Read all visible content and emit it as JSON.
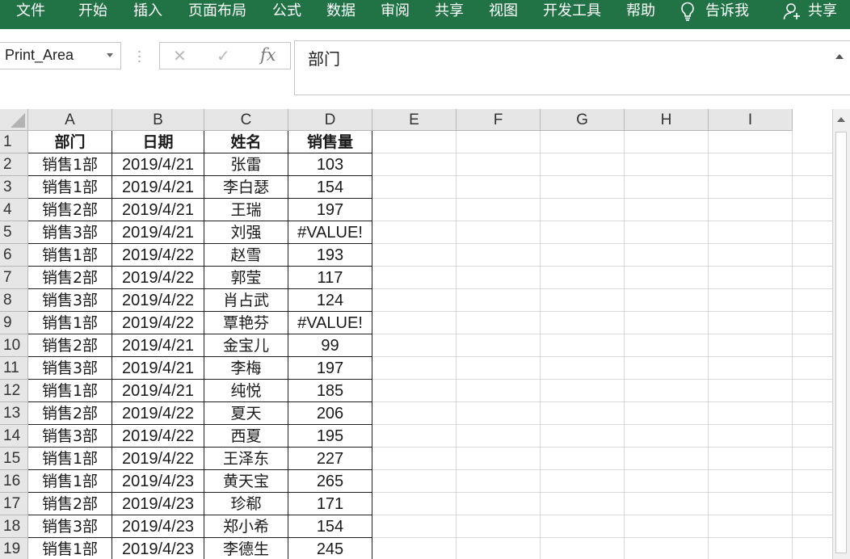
{
  "ribbon": {
    "tabs": [
      {
        "key": "file",
        "label": "文件"
      },
      {
        "key": "home",
        "label": "开始"
      },
      {
        "key": "insert",
        "label": "插入"
      },
      {
        "key": "layout",
        "label": "页面布局"
      },
      {
        "key": "formulas",
        "label": "公式"
      },
      {
        "key": "data",
        "label": "数据"
      },
      {
        "key": "review",
        "label": "审阅"
      },
      {
        "key": "share_tab",
        "label": "共享"
      },
      {
        "key": "view",
        "label": "视图"
      },
      {
        "key": "developer",
        "label": "开发工具"
      },
      {
        "key": "help",
        "label": "帮助"
      }
    ],
    "tell_me": {
      "icon": "lightbulb-icon",
      "label": "告诉我"
    },
    "share": {
      "icon": "person-add-icon",
      "label": "共享"
    },
    "color": "#217346"
  },
  "formula_bar": {
    "name_box": "Print_Area",
    "cancel_icon": "close-icon",
    "enter_icon": "check-icon",
    "function_label": "fx",
    "formula": "部门"
  },
  "sheet": {
    "columns": [
      "A",
      "B",
      "C",
      "D",
      "E",
      "F",
      "G",
      "H",
      "I"
    ],
    "row_numbers": [
      "1",
      "2",
      "3",
      "4",
      "5",
      "6",
      "7",
      "8",
      "9",
      "10",
      "11",
      "12",
      "13",
      "14",
      "15",
      "16",
      "17",
      "18",
      "19"
    ],
    "header": [
      "部门",
      "日期",
      "姓名",
      "销售量"
    ],
    "rows": [
      [
        "销售1部",
        "2019/4/21",
        "张雷",
        "103"
      ],
      [
        "销售1部",
        "2019/4/21",
        "李白瑟",
        "154"
      ],
      [
        "销售2部",
        "2019/4/21",
        "王瑞",
        "197"
      ],
      [
        "销售3部",
        "2019/4/21",
        "刘强",
        "#VALUE!"
      ],
      [
        "销售1部",
        "2019/4/22",
        "赵雪",
        "193"
      ],
      [
        "销售2部",
        "2019/4/22",
        "郭莹",
        "117"
      ],
      [
        "销售3部",
        "2019/4/22",
        "肖占武",
        "124"
      ],
      [
        "销售1部",
        "2019/4/22",
        "覃艳芬",
        "#VALUE!"
      ],
      [
        "销售2部",
        "2019/4/21",
        "金宝儿",
        "99"
      ],
      [
        "销售3部",
        "2019/4/21",
        "李梅",
        "197"
      ],
      [
        "销售1部",
        "2019/4/21",
        "纯悦",
        "185"
      ],
      [
        "销售2部",
        "2019/4/22",
        "夏天",
        "206"
      ],
      [
        "销售3部",
        "2019/4/22",
        "西夏",
        "195"
      ],
      [
        "销售1部",
        "2019/4/22",
        "王泽东",
        "227"
      ],
      [
        "销售1部",
        "2019/4/23",
        "黄天宝",
        "265"
      ],
      [
        "销售2部",
        "2019/4/23",
        "珍郗",
        "171"
      ],
      [
        "销售3部",
        "2019/4/23",
        "郑小希",
        "154"
      ],
      [
        "销售1部",
        "2019/4/23",
        "李德生",
        "245"
      ]
    ]
  }
}
